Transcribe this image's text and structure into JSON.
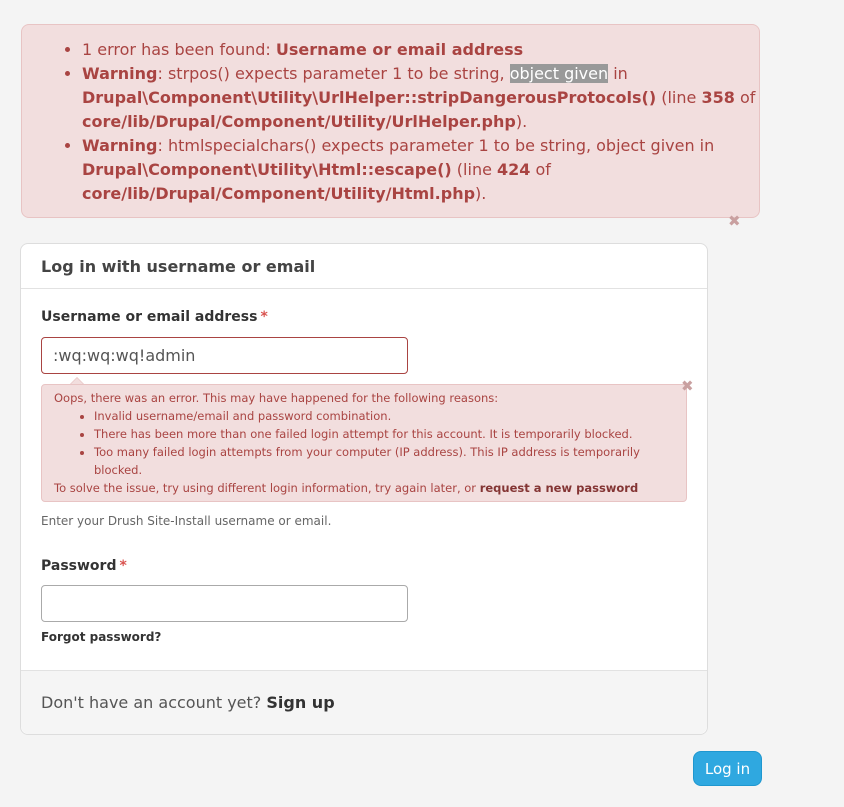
{
  "top_error": {
    "line1_prefix": "1 error has been found: ",
    "line1_link": "Username or email address",
    "w1_label": "Warning",
    "w1_text_a": ": strpos() expects parameter 1 to be string, ",
    "w1_highlight": "object given",
    "w1_text_b": " in ",
    "w1_func": "Drupal\\Component\\Utility\\UrlHelper::stripDangerousProtocols()",
    "w1_line_pre": " (line ",
    "w1_line_num": "358",
    "w1_of": " of ",
    "w1_file": "core/lib/Drupal/Component/Utility/UrlHelper.php",
    "w1_end": ").",
    "w2_label": "Warning",
    "w2_text": ": htmlspecialchars() expects parameter 1 to be string, object given in ",
    "w2_func": "Drupal\\Component\\Utility\\Html::escape()",
    "w2_line_pre": " (line ",
    "w2_line_num": "424",
    "w2_of": " of ",
    "w2_file": "core/lib/Drupal/Component/Utility/Html.php",
    "w2_end": ")."
  },
  "close_glyph": "✖",
  "card": {
    "title": "Log in with username or email",
    "username_label": "Username or email address",
    "required_mark": "*",
    "username_value": ":wq:wq:wq!admin",
    "error_msg": {
      "intro": "Oops, there was an error. This may have happened for the following reasons:",
      "reasons": [
        "Invalid username/email and password combination.",
        "There has been more than one failed login attempt for this account. It is temporarily blocked.",
        "Too many failed login attempts from your computer (IP address). This IP address is temporarily blocked."
      ],
      "solve_text": "To solve the issue, try using different login information, try again later, or ",
      "solve_link": "request a new password"
    },
    "username_desc": "Enter your Drush Site-Install username or email.",
    "password_label": "Password",
    "password_value": "",
    "forgot": "Forgot password?",
    "footer_text": "Don't have an account yet? ",
    "footer_link": "Sign up"
  },
  "login_button": "Log in",
  "colors": {
    "error_bg": "#f2dede",
    "error_text": "#a94442",
    "button_bg": "#2fa8e0"
  }
}
